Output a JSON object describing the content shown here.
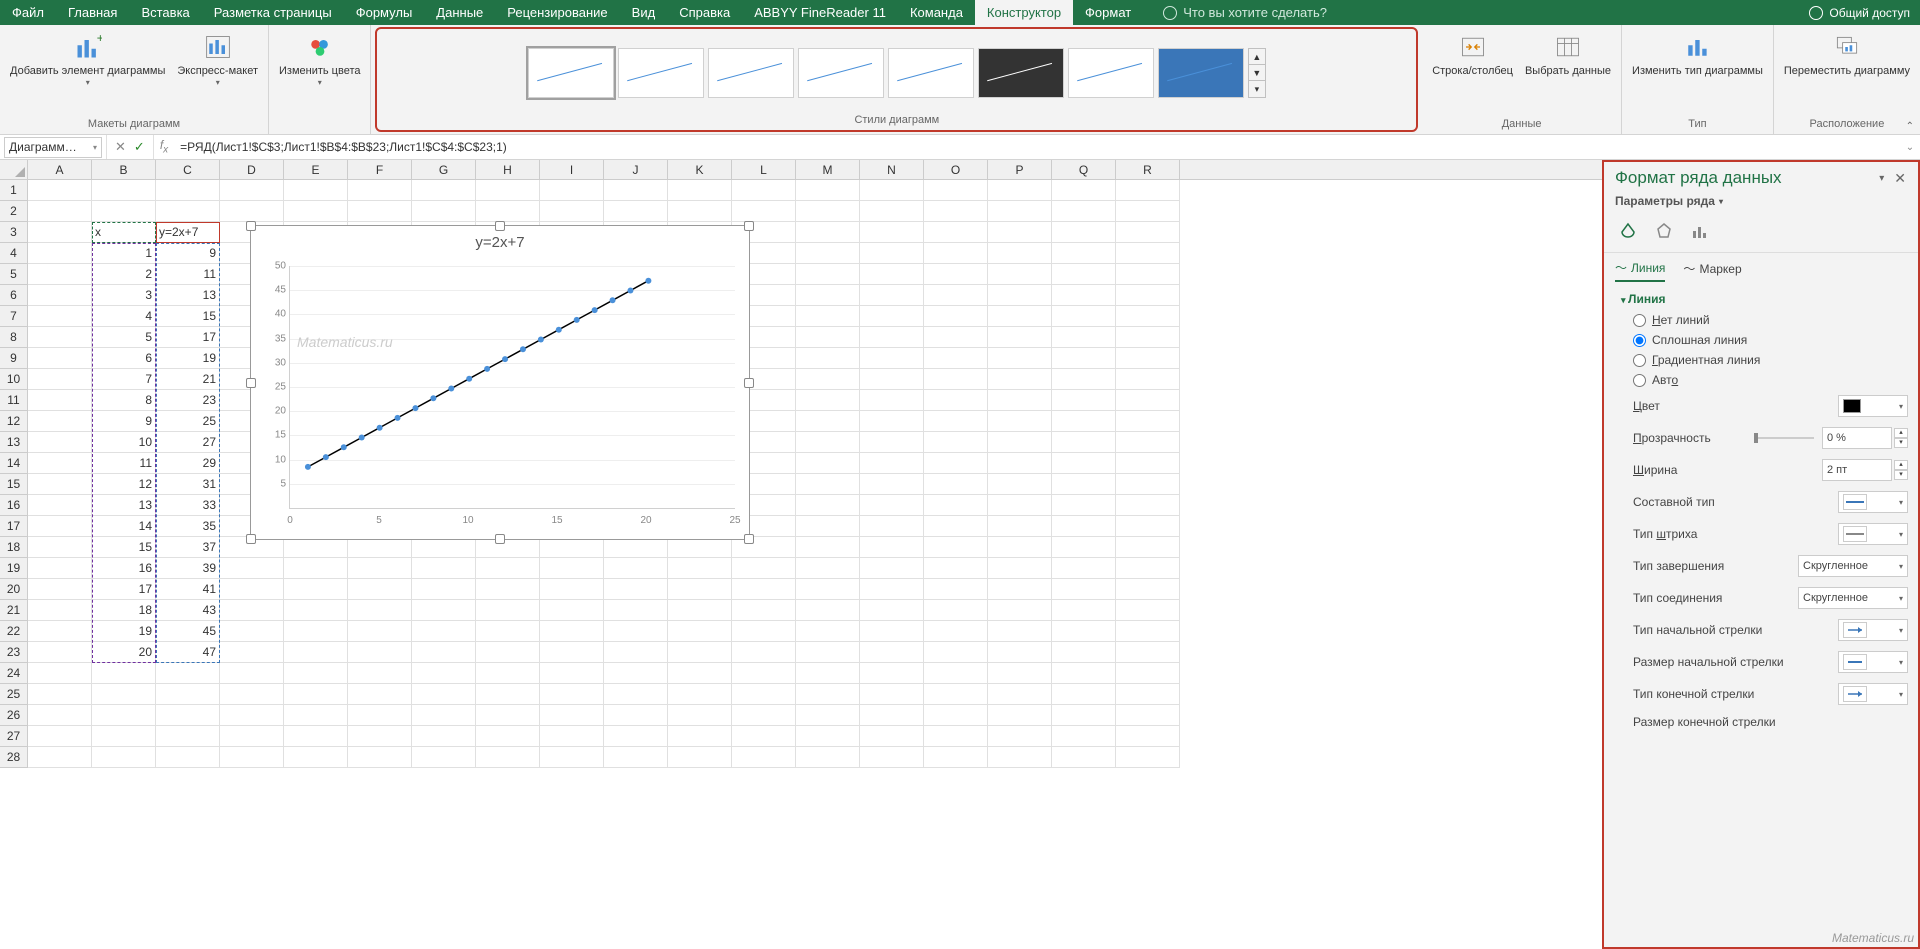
{
  "titlebar": {
    "tabs": [
      "Файл",
      "Главная",
      "Вставка",
      "Разметка страницы",
      "Формулы",
      "Данные",
      "Рецензирование",
      "Вид",
      "Справка",
      "ABBYY FineReader 11",
      "Команда",
      "Конструктор",
      "Формат"
    ],
    "active_tab": "Конструктор",
    "tellme": "Что вы хотите сделать?",
    "share": "Общий доступ"
  },
  "ribbon": {
    "layouts": {
      "add_elem": "Добавить элемент диаграммы",
      "quick": "Экспресс-макет",
      "group": "Макеты диаграмм"
    },
    "colors": {
      "btn": "Изменить цвета"
    },
    "styles_group": "Стили диаграмм",
    "data": {
      "switch": "Строка/столбец",
      "select": "Выбрать данные",
      "group": "Данные"
    },
    "type": {
      "change": "Изменить тип диаграммы",
      "group": "Тип"
    },
    "move": {
      "btn": "Переместить диаграмму",
      "group": "Расположение"
    }
  },
  "fbar": {
    "name": "Диаграмм…",
    "formula": "=РЯД(Лист1!$C$3;Лист1!$B$4:$B$23;Лист1!$C$4:$C$23;1)"
  },
  "columns": [
    "A",
    "B",
    "C",
    "D",
    "E",
    "F",
    "G",
    "H",
    "I",
    "J",
    "K",
    "L",
    "M",
    "N",
    "O",
    "P",
    "Q",
    "R"
  ],
  "grid": {
    "b3": "x",
    "c3": "y=2x+7",
    "rows": [
      {
        "r": 4,
        "b": "1",
        "c": "9"
      },
      {
        "r": 5,
        "b": "2",
        "c": "11"
      },
      {
        "r": 6,
        "b": "3",
        "c": "13"
      },
      {
        "r": 7,
        "b": "4",
        "c": "15"
      },
      {
        "r": 8,
        "b": "5",
        "c": "17"
      },
      {
        "r": 9,
        "b": "6",
        "c": "19"
      },
      {
        "r": 10,
        "b": "7",
        "c": "21"
      },
      {
        "r": 11,
        "b": "8",
        "c": "23"
      },
      {
        "r": 12,
        "b": "9",
        "c": "25"
      },
      {
        "r": 13,
        "b": "10",
        "c": "27"
      },
      {
        "r": 14,
        "b": "11",
        "c": "29"
      },
      {
        "r": 15,
        "b": "12",
        "c": "31"
      },
      {
        "r": 16,
        "b": "13",
        "c": "33"
      },
      {
        "r": 17,
        "b": "14",
        "c": "35"
      },
      {
        "r": 18,
        "b": "15",
        "c": "37"
      },
      {
        "r": 19,
        "b": "16",
        "c": "39"
      },
      {
        "r": 20,
        "b": "17",
        "c": "41"
      },
      {
        "r": 21,
        "b": "18",
        "c": "43"
      },
      {
        "r": 22,
        "b": "19",
        "c": "45"
      },
      {
        "r": 23,
        "b": "20",
        "c": "47"
      }
    ]
  },
  "chart_data": {
    "type": "line",
    "title": "y=2x+7",
    "x": [
      1,
      2,
      3,
      4,
      5,
      6,
      7,
      8,
      9,
      10,
      11,
      12,
      13,
      14,
      15,
      16,
      17,
      18,
      19,
      20
    ],
    "y": [
      9,
      11,
      13,
      15,
      17,
      19,
      21,
      23,
      25,
      27,
      29,
      31,
      33,
      35,
      37,
      39,
      41,
      43,
      45,
      47
    ],
    "xlim": [
      0,
      25
    ],
    "ylim": [
      0,
      50
    ],
    "xticks": [
      0,
      5,
      10,
      15,
      20,
      25
    ],
    "yticks": [
      5,
      10,
      15,
      20,
      25,
      30,
      35,
      40,
      45,
      50
    ],
    "xlabel": "",
    "ylabel": "",
    "watermark": "Matematicus.ru"
  },
  "rpane": {
    "title": "Формат ряда данных",
    "subtitle": "Параметры ряда",
    "tabs": {
      "line": "Линия",
      "marker": "Маркер"
    },
    "section": "Линия",
    "radios": {
      "none": "Нет линий",
      "solid": "Сплошная линия",
      "grad": "Градиентная линия",
      "auto": "Авто"
    },
    "props": {
      "color": "Цвет",
      "transparency": "Прозрачность",
      "transparency_val": "0 %",
      "width": "Ширина",
      "width_val": "2 пт",
      "compound": "Составной тип",
      "dash": "Тип штриха",
      "cap": "Тип завершения",
      "cap_val": "Скругленное",
      "join": "Тип соединения",
      "join_val": "Скругленное",
      "begin_arrow": "Тип начальной стрелки",
      "begin_size": "Размер начальной стрелки",
      "end_arrow": "Тип конечной стрелки",
      "end_size": "Размер конечной стрелки"
    }
  },
  "watermark2": "Matematicus.ru"
}
